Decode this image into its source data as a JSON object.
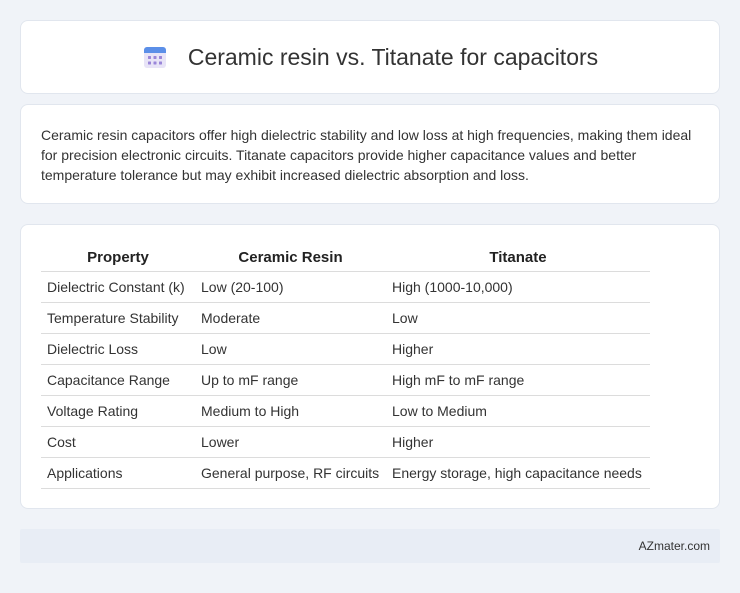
{
  "header": {
    "title": "Ceramic resin vs. Titanate for capacitors",
    "icon": "calendar-icon"
  },
  "intro": {
    "text": "Ceramic resin capacitors offer high dielectric stability and low loss at high frequencies, making them ideal for precision electronic circuits. Titanate capacitors provide higher capacitance values and better temperature tolerance but may exhibit increased dielectric absorption and loss."
  },
  "table": {
    "headers": [
      "Property",
      "Ceramic Resin",
      "Titanate"
    ],
    "rows": [
      [
        "Dielectric Constant (k)",
        "Low (20-100)",
        "High (1000-10,000)"
      ],
      [
        "Temperature Stability",
        "Moderate",
        "Low"
      ],
      [
        "Dielectric Loss",
        "Low",
        "Higher"
      ],
      [
        "Capacitance Range",
        "Up to mF range",
        "High mF to mF range"
      ],
      [
        "Voltage Rating",
        "Medium to High",
        "Low to Medium"
      ],
      [
        "Cost",
        "Lower",
        "Higher"
      ],
      [
        "Applications",
        "General purpose, RF circuits",
        "Energy storage, high capacitance needs"
      ]
    ]
  },
  "footer": {
    "brand": "AZmater.com"
  }
}
